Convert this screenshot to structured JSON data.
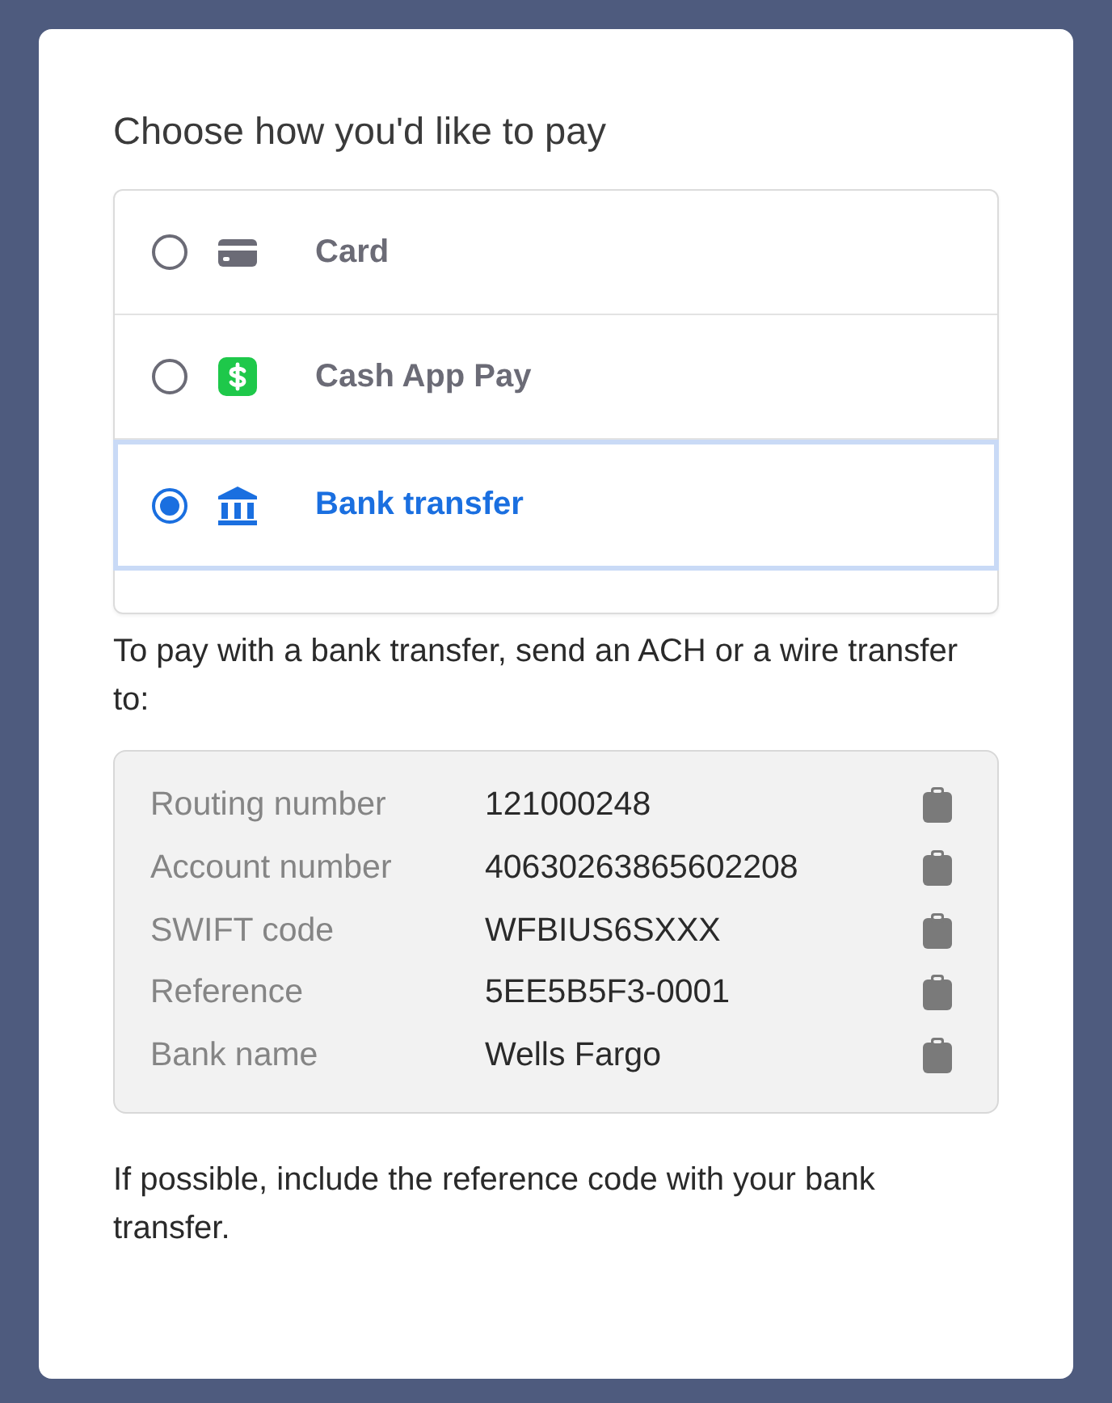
{
  "heading": "Choose how you'd like to pay",
  "payment_methods": [
    {
      "kind": "card",
      "label": "Card",
      "selected": false
    },
    {
      "kind": "cashapp",
      "label": "Cash App Pay",
      "selected": false
    },
    {
      "kind": "bank",
      "label": "Bank transfer",
      "selected": true
    }
  ],
  "instructions": "To pay with a bank transfer, send an ACH or a wire transfer to:",
  "bank_details": [
    {
      "label": "Routing number",
      "value": "121000248"
    },
    {
      "label": "Account number",
      "value": "40630263865602208"
    },
    {
      "label": "SWIFT code",
      "value": "WFBIUS6SXXX"
    },
    {
      "label": "Reference",
      "value": "5EE5B5F3-0001"
    },
    {
      "label": "Bank name",
      "value": "Wells Fargo"
    }
  ],
  "note": "If possible, include the reference code with your bank transfer."
}
